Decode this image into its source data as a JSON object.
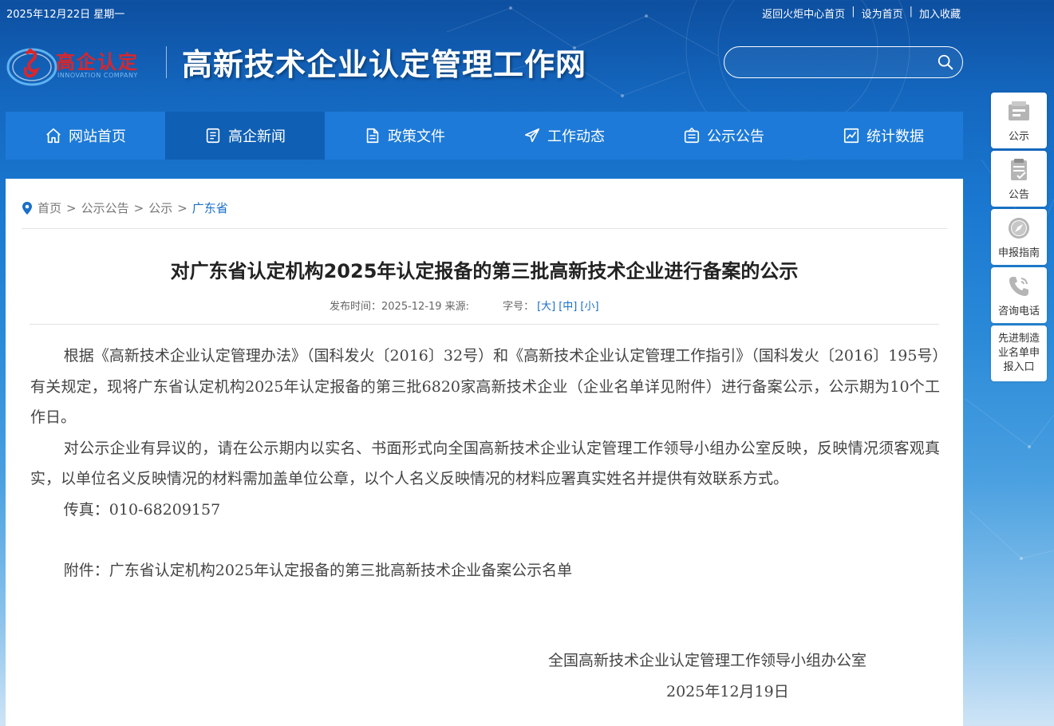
{
  "topbar": {
    "date": "2025年12月22日 星期一",
    "links": [
      "返回火炬中心首页",
      "设为首页",
      "加入收藏"
    ],
    "separator": "|"
  },
  "header": {
    "logo_cn": "高企认定",
    "logo_en": "INNOVATION COMPANY",
    "site_title": "高新技术企业认定管理工作网",
    "search_placeholder": ""
  },
  "nav": {
    "items": [
      {
        "label": "网站首页",
        "icon": "home-icon"
      },
      {
        "label": "高企新闻",
        "icon": "news-icon"
      },
      {
        "label": "政策文件",
        "icon": "document-icon"
      },
      {
        "label": "工作动态",
        "icon": "paper-plane-icon"
      },
      {
        "label": "公示公告",
        "icon": "announcement-icon"
      },
      {
        "label": "统计数据",
        "icon": "chart-icon"
      }
    ],
    "active_index": 1
  },
  "breadcrumb": {
    "items": [
      "首页",
      "公示公告",
      "公示",
      "广东省"
    ],
    "separator": ">"
  },
  "article": {
    "title": "对广东省认定机构2025年认定报备的第三批高新技术企业进行备案的公示",
    "meta_published": "发布时间：2025-12-19 来源:",
    "meta_fontsize_label": "字号：",
    "font_sizes": [
      "[大]",
      "[中]",
      "[小]"
    ],
    "paragraphs": [
      "根据《高新技术企业认定管理办法》（国科发火〔2016〕32号）和《高新技术企业认定管理工作指引》（国科发火〔2016〕195号）有关规定，现将广东省认定机构2025年认定报备的第三批6820家高新技术企业（企业名单详见附件）进行备案公示，公示期为10个工作日。",
      "对公示企业有异议的，请在公示期内以实名、书面形式向全国高新技术企业认定管理工作领导小组办公室反映，反映情况须客观真实，以单位名义反映情况的材料需加盖单位公章，以个人名义反映情况的材料应署真实姓名并提供有效联系方式。",
      "传真：010-68209157"
    ],
    "attachment": "附件：广东省认定机构2025年认定报备的第三批高新技术企业备案公示名单",
    "signature_org": "全国高新技术企业认定管理工作领导小组办公室",
    "signature_date": "2025年12月19日"
  },
  "sidebar": {
    "items": [
      {
        "label": "公示",
        "icon": "notice-board-icon"
      },
      {
        "label": "公告",
        "icon": "clipboard-icon"
      },
      {
        "label": "申报指南",
        "icon": "compass-icon"
      },
      {
        "label": "咨询电话",
        "icon": "phone-icon"
      },
      {
        "label": "先进制造业名单申报入口",
        "icon": ""
      }
    ]
  },
  "colors": {
    "nav_bg": "#1d7ad8",
    "nav_active": "#0f5fb4",
    "link_blue": "#1a6fc9",
    "logo_red": "#d9262c"
  }
}
